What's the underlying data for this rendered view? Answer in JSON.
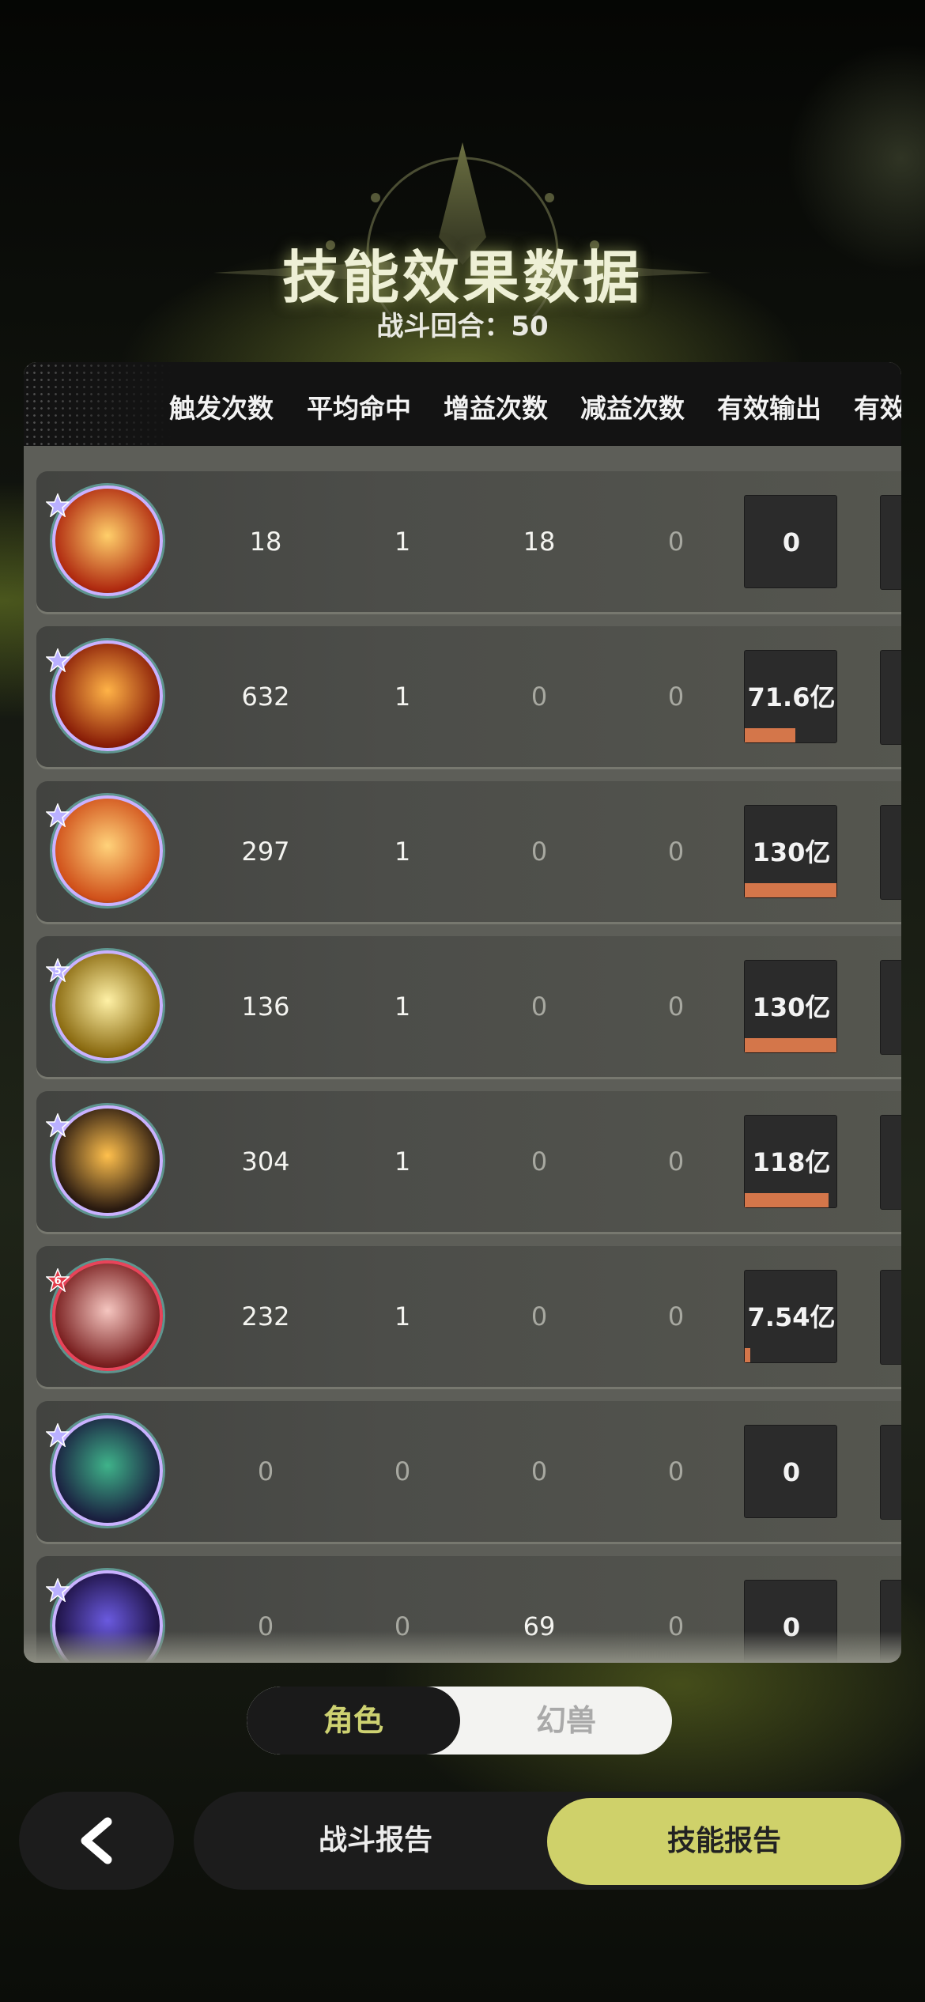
{
  "header": {
    "title": "技能效果数据",
    "round_label": "战斗回合：50"
  },
  "table": {
    "columns": [
      "触发次数",
      "平均命中",
      "增益次数",
      "减益次数",
      "有效输出",
      "有效"
    ],
    "rows": [
      {
        "icon": "fire-burst-skill-icon",
        "triggers": "18",
        "avg_hit": "1",
        "buffs": "18",
        "debuffs": "0",
        "output": "0",
        "output_fill": 0,
        "star": "",
        "star_color": "#b9b0ff",
        "ring": "#c9b2ff",
        "c1": "#ffcf6a",
        "c2": "#b02a10"
      },
      {
        "icon": "fire-comet-skill-icon",
        "triggers": "632",
        "avg_hit": "1",
        "buffs": "0",
        "debuffs": "0",
        "output": "71.6亿",
        "output_fill": 0.55,
        "star": "",
        "star_color": "#b9b0ff",
        "ring": "#c9b2ff",
        "c1": "#ffb347",
        "c2": "#8a1e08"
      },
      {
        "icon": "fire-swirl-skill-icon",
        "triggers": "297",
        "avg_hit": "1",
        "buffs": "0",
        "debuffs": "0",
        "output": "130亿",
        "output_fill": 1.0,
        "star": "",
        "star_color": "#b9b0ff",
        "ring": "#c9b2ff",
        "c1": "#ffd27a",
        "c2": "#d0501a"
      },
      {
        "icon": "lightning-star-skill-icon",
        "triggers": "136",
        "avg_hit": "1",
        "buffs": "0",
        "debuffs": "0",
        "output": "130亿",
        "output_fill": 1.0,
        "star": "5",
        "star_color": "#b9b0ff",
        "ring": "#c9b2ff",
        "c1": "#fff1a6",
        "c2": "#8a6a10"
      },
      {
        "icon": "campfire-skill-icon",
        "triggers": "304",
        "avg_hit": "1",
        "buffs": "0",
        "debuffs": "0",
        "output": "118亿",
        "output_fill": 0.91,
        "star": "",
        "star_color": "#b9b0ff",
        "ring": "#c9b2ff",
        "c1": "#ffc04d",
        "c2": "#2a1a10"
      },
      {
        "icon": "crimson-orb-skill-icon",
        "triggers": "232",
        "avg_hit": "1",
        "buffs": "0",
        "debuffs": "0",
        "output": "7.54亿",
        "output_fill": 0.06,
        "star": "6",
        "star_color": "#e23a4a",
        "ring": "#e8445a",
        "c1": "#f5c6c0",
        "c2": "#7a2020"
      },
      {
        "icon": "mystic-elements-skill-icon",
        "triggers": "0",
        "avg_hit": "0",
        "buffs": "0",
        "debuffs": "0",
        "output": "0",
        "output_fill": 0,
        "star": "",
        "star_color": "#b9b0ff",
        "ring": "#c9b2ff",
        "c1": "#3fb38a",
        "c2": "#1a2040"
      },
      {
        "icon": "cosmic-swirl-skill-icon",
        "triggers": "0",
        "avg_hit": "0",
        "buffs": "69",
        "debuffs": "0",
        "output": "0",
        "output_fill": 0,
        "star": "",
        "star_color": "#b9b0ff",
        "ring": "#c9b2ff",
        "c1": "#6a5adf",
        "c2": "#1c1040"
      }
    ]
  },
  "toggle": {
    "active": "角色",
    "inactive": "幻兽"
  },
  "footer": {
    "back_icon": "chevron-left-icon",
    "battle_report": "战斗报告",
    "skill_report": "技能报告"
  },
  "colors": {
    "accent": "#cfd16a",
    "bar": "#d4764a"
  }
}
